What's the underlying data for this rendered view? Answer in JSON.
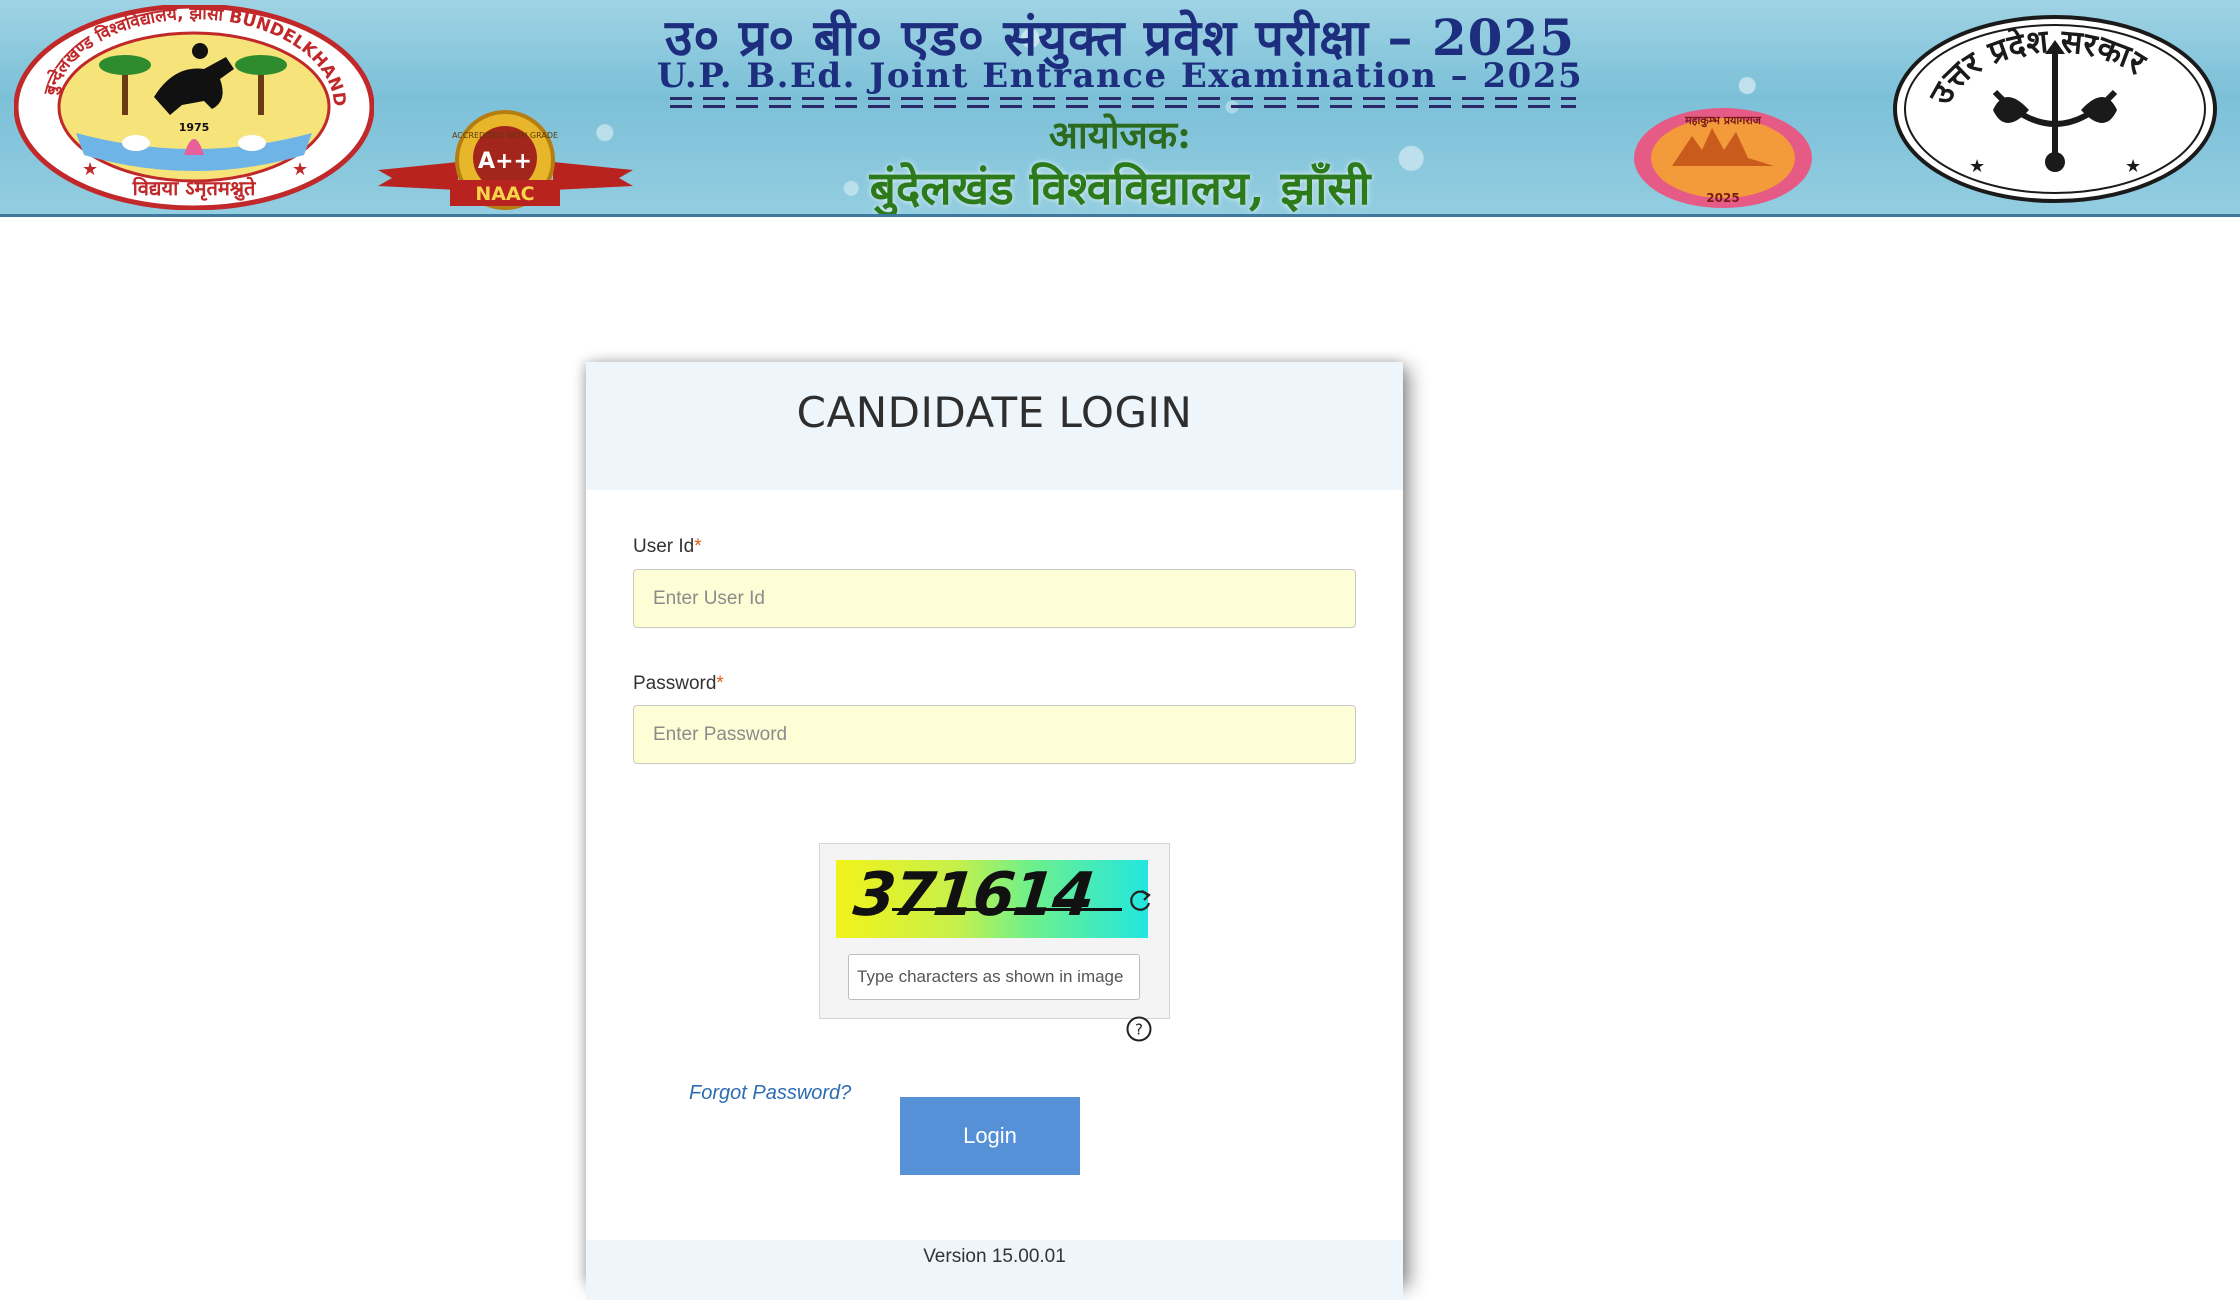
{
  "banner": {
    "title_hindi": "उ० प्र० बी० एड० संयुक्त प्रवेश परीक्षा – 2025",
    "title_english": "U.P. B.Ed. Joint Entrance Examination – 2025",
    "organizer_label": "आयोजक:",
    "organizer_name": "बुंदेलखंड विश्वविद्यालय, झाँसी",
    "university_seal_ring_text": "बुन्देलखण्ड विश्वविद्यालय, झांसी BUNDELKHAND UNIVERSITY, JHANSI",
    "university_seal_motto": "विद्यया ऽमृतमश्नुते",
    "university_seal_year": "1975",
    "naac_grade": "A++",
    "naac_ribbon": "NAAC",
    "naac_ring_text": "ACCREDITED WITH GRADE",
    "kumbh_text": "महाकुम्भ प्रयागराज",
    "kumbh_year": "2025",
    "up_emblem_text": "उत्तर प्रदेश सरकार"
  },
  "login": {
    "title": "CANDIDATE LOGIN",
    "user_id_label": "User Id",
    "user_id_placeholder": "Enter User Id",
    "user_id_value": "",
    "password_label": "Password",
    "password_placeholder": "Enter Password",
    "password_value": "",
    "required_marker": "*",
    "captcha_text": "371614",
    "captcha_placeholder": "Type characters as shown in image",
    "captcha_value": "",
    "forgot_password": "Forgot Password?",
    "login_button": "Login",
    "version": "Version 15.00.01"
  },
  "colors": {
    "banner_title": "#1c2e7d",
    "banner_organizer": "#2c7a1a",
    "card_header_bg": "#eef6fc",
    "input_bg": "#fdfdd6",
    "login_button": "#5690d6",
    "link": "#2b6cb3",
    "required": "#e05a1a"
  },
  "icons": {
    "captcha_refresh": "refresh-icon",
    "captcha_help": "question-circle-icon"
  }
}
